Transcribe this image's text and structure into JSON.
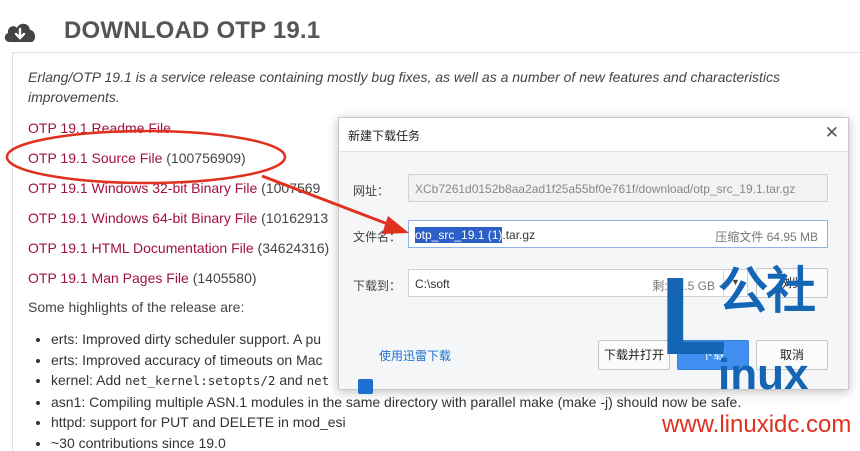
{
  "header": {
    "title": "DOWNLOAD OTP 19.1",
    "icon": "cloud-download-icon"
  },
  "intro": "Erlang/OTP 19.1 is a service release containing mostly bug fixes, as well as a number of new features and characteristics improvements.",
  "downloads": [
    {
      "label": "OTP 19.1 Readme File",
      "size": ""
    },
    {
      "label": "OTP 19.1 Source File",
      "size": "(100756909)"
    },
    {
      "label": "OTP 19.1 Windows 32-bit Binary File",
      "size": "(1007569"
    },
    {
      "label": "OTP 19.1 Windows 64-bit Binary File",
      "size": "(10162913"
    },
    {
      "label": "OTP 19.1 HTML Documentation File",
      "size": "(34624316)"
    },
    {
      "label": "OTP 19.1 Man Pages File",
      "size": "(1405580)"
    }
  ],
  "highlights_heading": "Some highlights of the release are:",
  "bullets": [
    {
      "text": "erts: Improved dirty scheduler support. A pu"
    },
    {
      "text": "erts: Improved accuracy of timeouts on Mac"
    },
    {
      "pre": "kernel: Add ",
      "code1": "net_kernel:setopts/2",
      "mid": " and ",
      "code2": "net"
    },
    {
      "text": "asn1: Compiling multiple ASN.1 modules in the same directory with parallel make (make -j) should now be safe."
    },
    {
      "text": "httpd: support for PUT and DELETE in mod_esi"
    },
    {
      "text": "~30 contributions since 19.0"
    }
  ],
  "dialog": {
    "title": "新建下载任务",
    "close": "✕",
    "url_label": "网址：",
    "url_value": "XCb7261d0152b8aa2ad1f25a55bf0e761f/download/otp_src_19.1.tar.gz",
    "filename_label": "文件名：",
    "filename_selected": "otp_src_19.1 (1)",
    "filename_ext": ".tar.gz",
    "filesize": "压缩文件 64.95 MB",
    "saveto_label": "下载到：",
    "saveto_value": "C:\\soft",
    "free_space": "剩: 71.5 GB",
    "browse_button": "浏览",
    "thunder_label": "使用迅雷下载",
    "download_open_button": "下载并打开",
    "download_button": "下载",
    "cancel_button": "取消"
  },
  "watermark": {
    "letter": "L",
    "cn_text": "公社",
    "inux": "inux",
    "url": "www.linuxidc.com"
  },
  "colors": {
    "link": "#a1123f",
    "annotation": "#e0301e",
    "primary_button": "#3f8ef0",
    "watermark_blue": "#1565b5"
  }
}
